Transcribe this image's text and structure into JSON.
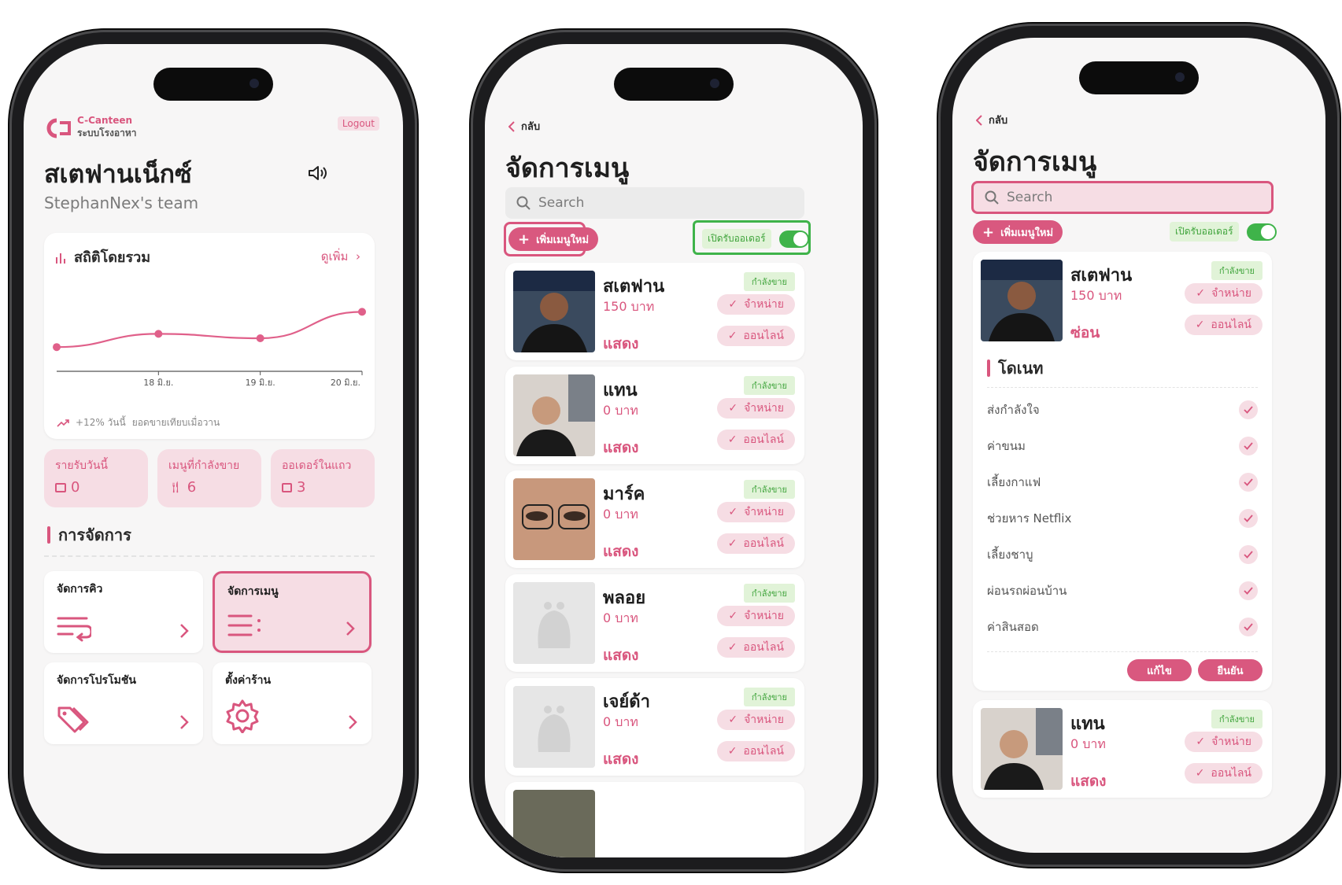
{
  "phone1": {
    "brand_name": "C-Canteen",
    "brand_sub": "ระบบโรงอาหา",
    "logout": "Logout",
    "shop_name": "สเตฟานเน็กซ์",
    "team": "StephanNex's team",
    "stats": {
      "title": "สถิติโดยรวม",
      "more": "ดูเพิ่ม",
      "trend_pct": "+12% วันนี้",
      "trend_text": "ยอดขายเทียบเมื่อวาน",
      "chart_data": {
        "type": "line",
        "categories": [
          "",
          "18 มิ.ย.",
          "19 มิ.ย.",
          "20 มิ.ย."
        ],
        "values": [
          2.2,
          3.4,
          3.0,
          5.4
        ],
        "ylim": [
          0,
          9
        ]
      }
    },
    "kpis": [
      {
        "label": "รายรับวันนี้",
        "value": "0",
        "icon": "wallet-icon"
      },
      {
        "label": "เมนูที่กำลังขาย",
        "value": "6",
        "icon": "utensils-icon"
      },
      {
        "label": "ออเดอร์ในแถว",
        "value": "3",
        "icon": "list-icon"
      }
    ],
    "manage_title": "การจัดการ",
    "manage": [
      {
        "label": "จัดการคิว",
        "icon": "queue-icon"
      },
      {
        "label": "จัดการเมนู",
        "icon": "menu-list-icon"
      },
      {
        "label": "จัดการโปรโมชัน",
        "icon": "tag-icon"
      },
      {
        "label": "ตั้งค่าร้าน",
        "icon": "gear-icon"
      }
    ]
  },
  "phone2": {
    "back": "กลับ",
    "title": "จัดการเมนู",
    "search_placeholder": "Search",
    "add_button": "เพิ่มเมนูใหม่",
    "open_orders": "เปิดรับออเดอร์",
    "items": [
      {
        "name": "สเตฟาน",
        "price": "150 บาท",
        "visibility": "แสดง",
        "status": "กำลังขาย",
        "sell": "จำหน่าย",
        "online": "ออนไลน์"
      },
      {
        "name": "แทน",
        "price": "0 บาท",
        "visibility": "แสดง",
        "status": "กำลังขาย",
        "sell": "จำหน่าย",
        "online": "ออนไลน์"
      },
      {
        "name": "มาร์ค",
        "price": "0 บาท",
        "visibility": "แสดง",
        "status": "กำลังขาย",
        "sell": "จำหน่าย",
        "online": "ออนไลน์"
      },
      {
        "name": "พลอย",
        "price": "0 บาท",
        "visibility": "แสดง",
        "status": "กำลังขาย",
        "sell": "จำหน่าย",
        "online": "ออนไลน์"
      },
      {
        "name": "เจย์ด้า",
        "price": "0 บาท",
        "visibility": "แสดง",
        "status": "กำลังขาย",
        "sell": "จำหน่าย",
        "online": "ออนไลน์"
      }
    ]
  },
  "phone3": {
    "back": "กลับ",
    "title": "จัดการเมนู",
    "search_placeholder": "Search",
    "add_button": "เพิ่มเมนูใหม่",
    "open_orders": "เปิดรับออเดอร์",
    "item1": {
      "name": "สเตฟาน",
      "price": "150 บาท",
      "visibility": "ซ่อน",
      "status": "กำลังขาย",
      "sell": "จำหน่าย",
      "online": "ออนไลน์"
    },
    "donate_title": "โดเนท",
    "donate_options": [
      "ส่งกำลังใจ",
      "ค่าขนม",
      "เลี้ยงกาแฟ",
      "ช่วยหาร Netflix",
      "เลี้ยงชาบู",
      "ผ่อนรถผ่อนบ้าน",
      "ค่าสินสอด"
    ],
    "edit": "แก้ไข",
    "confirm": "ยืนยัน",
    "item2": {
      "name": "แทน",
      "price": "0 บาท",
      "visibility": "แสดง",
      "status": "กำลังขาย",
      "sell": "จำหน่าย",
      "online": "ออนไลน์"
    }
  }
}
